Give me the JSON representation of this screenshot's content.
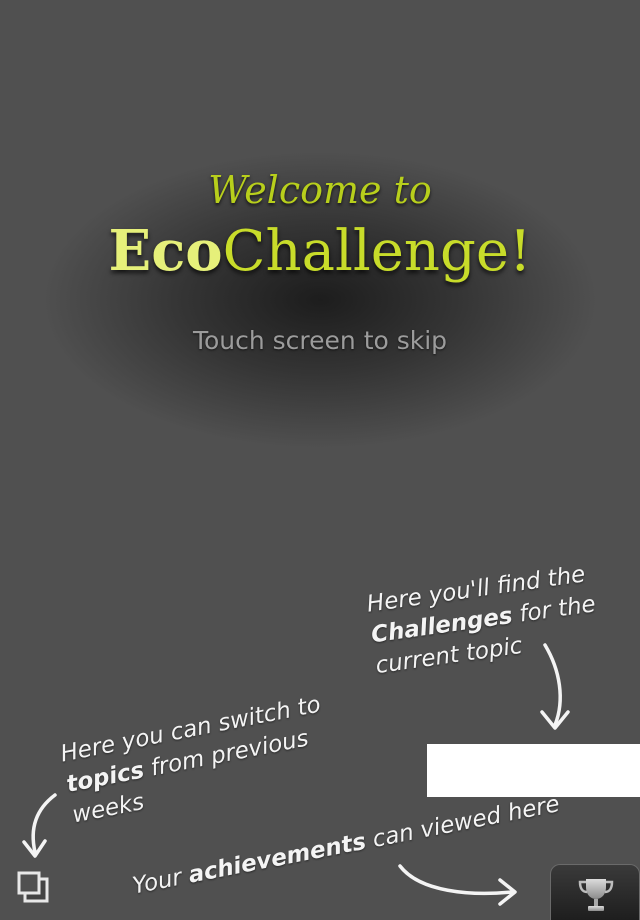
{
  "intro": {
    "welcome": "Welcome to",
    "title_eco": "Eco",
    "title_challenge": "Challenge!",
    "skip_hint": "Touch screen to skip"
  },
  "hints": {
    "challenges": {
      "line1": "Here you'll find the",
      "line2_bold": "Challenges",
      "line2_rest": " for the",
      "line3": "current topic"
    },
    "topics": {
      "line1": "Here you can switch to",
      "line2_bold": "topics",
      "line2_rest": " from previous",
      "line3": "weeks"
    },
    "achievements": {
      "before": "Your ",
      "bold": "achievements",
      "after": " can viewed here"
    }
  },
  "icons": {
    "switch": "switch-topics-icon",
    "trophy": "trophy-icon"
  },
  "colors": {
    "background": "#505050",
    "accent": "#c4da25",
    "accent_light": "#e6f07a",
    "hint_text": "#f4f4f4",
    "skip_text": "#9c9c9c"
  }
}
